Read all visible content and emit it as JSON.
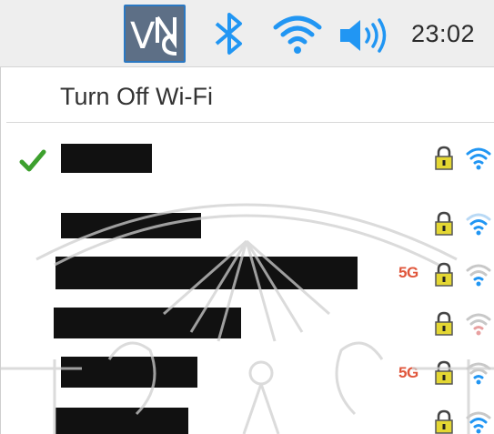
{
  "taskbar": {
    "clock": "23:02",
    "icons": [
      "vnc-icon",
      "bluetooth-icon",
      "wifi-icon",
      "volume-icon"
    ],
    "accent": "#2196f3"
  },
  "menu": {
    "turn_off_label": "Turn Off Wi-Fi",
    "networks": [
      {
        "name_redacted": true,
        "connected": true,
        "secured": true,
        "band_badge": "",
        "signal": 4
      },
      {
        "name_redacted": true,
        "connected": false,
        "secured": true,
        "band_badge": "",
        "signal": 3
      },
      {
        "name_redacted": true,
        "connected": false,
        "secured": true,
        "band_badge": "5G",
        "signal": 2
      },
      {
        "name_redacted": true,
        "connected": false,
        "secured": true,
        "band_badge": "",
        "signal": 2
      },
      {
        "name_redacted": true,
        "connected": false,
        "secured": true,
        "band_badge": "5G",
        "signal": 2
      },
      {
        "name_redacted": true,
        "connected": false,
        "secured": true,
        "band_badge": "",
        "signal": 3
      }
    ]
  },
  "colors": {
    "connected_check": "#3da02e",
    "badge_5g": "#e0563b",
    "lock_body": "#e4d733",
    "redaction": "#111111"
  }
}
